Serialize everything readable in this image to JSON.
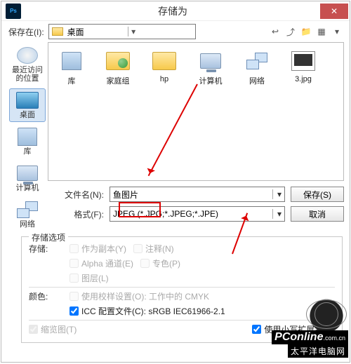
{
  "window": {
    "title": "存储为",
    "app_icon": "Ps"
  },
  "path": {
    "label": "保存在(I):",
    "value": "桌面"
  },
  "toolbar_icons": [
    "back-icon",
    "up-icon",
    "new-folder-icon",
    "view-icon",
    "menu-icon"
  ],
  "sidebar": [
    {
      "id": "recent",
      "label": "最近访问的位置",
      "icon": "recent"
    },
    {
      "id": "desktop",
      "label": "桌面",
      "icon": "desktop",
      "selected": true
    },
    {
      "id": "library",
      "label": "库",
      "icon": "lib"
    },
    {
      "id": "computer",
      "label": "计算机",
      "icon": "computer"
    },
    {
      "id": "network",
      "label": "网络",
      "icon": "net"
    }
  ],
  "items": [
    {
      "label": "库",
      "icon": "lib"
    },
    {
      "label": "家庭组",
      "icon": "group"
    },
    {
      "label": "hp",
      "icon": "folder"
    },
    {
      "label": "计算机",
      "icon": "computer"
    },
    {
      "label": "网络",
      "icon": "net"
    },
    {
      "label": "3.jpg",
      "icon": "thumb"
    }
  ],
  "filename": {
    "label": "文件名(N):",
    "value": "鱼图片"
  },
  "format": {
    "label": "格式(F):",
    "value": "JPEG (*.JPG;*.JPEG;*.JPE)"
  },
  "buttons": {
    "save": "保存(S)",
    "cancel": "取消"
  },
  "options": {
    "legend": "存储选项",
    "save_label": "存储:",
    "as_copy": "作为副本(Y)",
    "notes": "注释(N)",
    "alpha": "Alpha 通道(E)",
    "spot": "专色(P)",
    "layers": "图层(L)",
    "color_label": "颜色:",
    "proof": "使用校样设置(O): 工作中的 CMYK",
    "icc": "ICC 配置文件(C): sRGB IEC61966-2.1",
    "thumbnail": "缩览图(T)",
    "lowercase_ext": "使用小写扩展名(U)"
  },
  "watermark": {
    "line1": "PConline",
    "suffix": ".com.cn",
    "line2": "太平洋电脑网"
  }
}
